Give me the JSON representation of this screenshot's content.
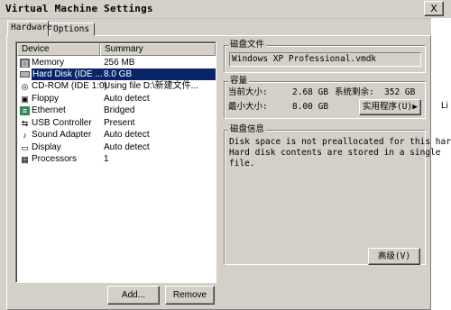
{
  "window": {
    "title": "Virtual Machine Settings",
    "close_label": "X"
  },
  "background": {
    "right_text": "Li"
  },
  "tabs": [
    {
      "label": "Hardware"
    },
    {
      "label": "Options"
    }
  ],
  "device_list": {
    "headers": {
      "device": "Device",
      "summary": "Summary"
    },
    "rows": [
      {
        "icon": "memory-icon",
        "device": "Memory",
        "summary": "256 MB"
      },
      {
        "icon": "hard-disk-icon",
        "device": "Hard Disk (IDE ...",
        "summary": "8.0 GB"
      },
      {
        "icon": "cdrom-icon",
        "device": "CD-ROM (IDE 1:0)",
        "summary": "Using file D:\\新建文件..."
      },
      {
        "icon": "floppy-icon",
        "device": "Floppy",
        "summary": "Auto detect"
      },
      {
        "icon": "ethernet-icon",
        "device": "Ethernet",
        "summary": "Bridged"
      },
      {
        "icon": "usb-icon",
        "device": "USB Controller",
        "summary": "Present"
      },
      {
        "icon": "sound-icon",
        "device": "Sound Adapter",
        "summary": "Auto detect"
      },
      {
        "icon": "display-icon",
        "device": "Display",
        "summary": "Auto detect"
      },
      {
        "icon": "processor-icon",
        "device": "Processors",
        "summary": "1"
      }
    ],
    "selected_index": 1
  },
  "buttons": {
    "add": "Add...",
    "remove": "Remove",
    "utilities": "实用程序(U)▶",
    "advanced": "高级(V)"
  },
  "disk_file": {
    "label": "磁盘文件",
    "value": "Windows XP Professional.vmdk"
  },
  "capacity": {
    "label": "容量",
    "current_label": "当前大小:",
    "current_value": "2.68 GB",
    "free_label": "系统剩余:",
    "free_value": "352 GB",
    "max_label": "最小大小:",
    "max_value": "8.00 GB"
  },
  "disk_info": {
    "label": "磁盘信息",
    "line1": "Disk space is not preallocated for this hard",
    "line2": "Hard disk contents are stored in a single",
    "line3": "file."
  },
  "colors": {
    "selection": "#0a246a",
    "face": "#d4d0c8"
  }
}
